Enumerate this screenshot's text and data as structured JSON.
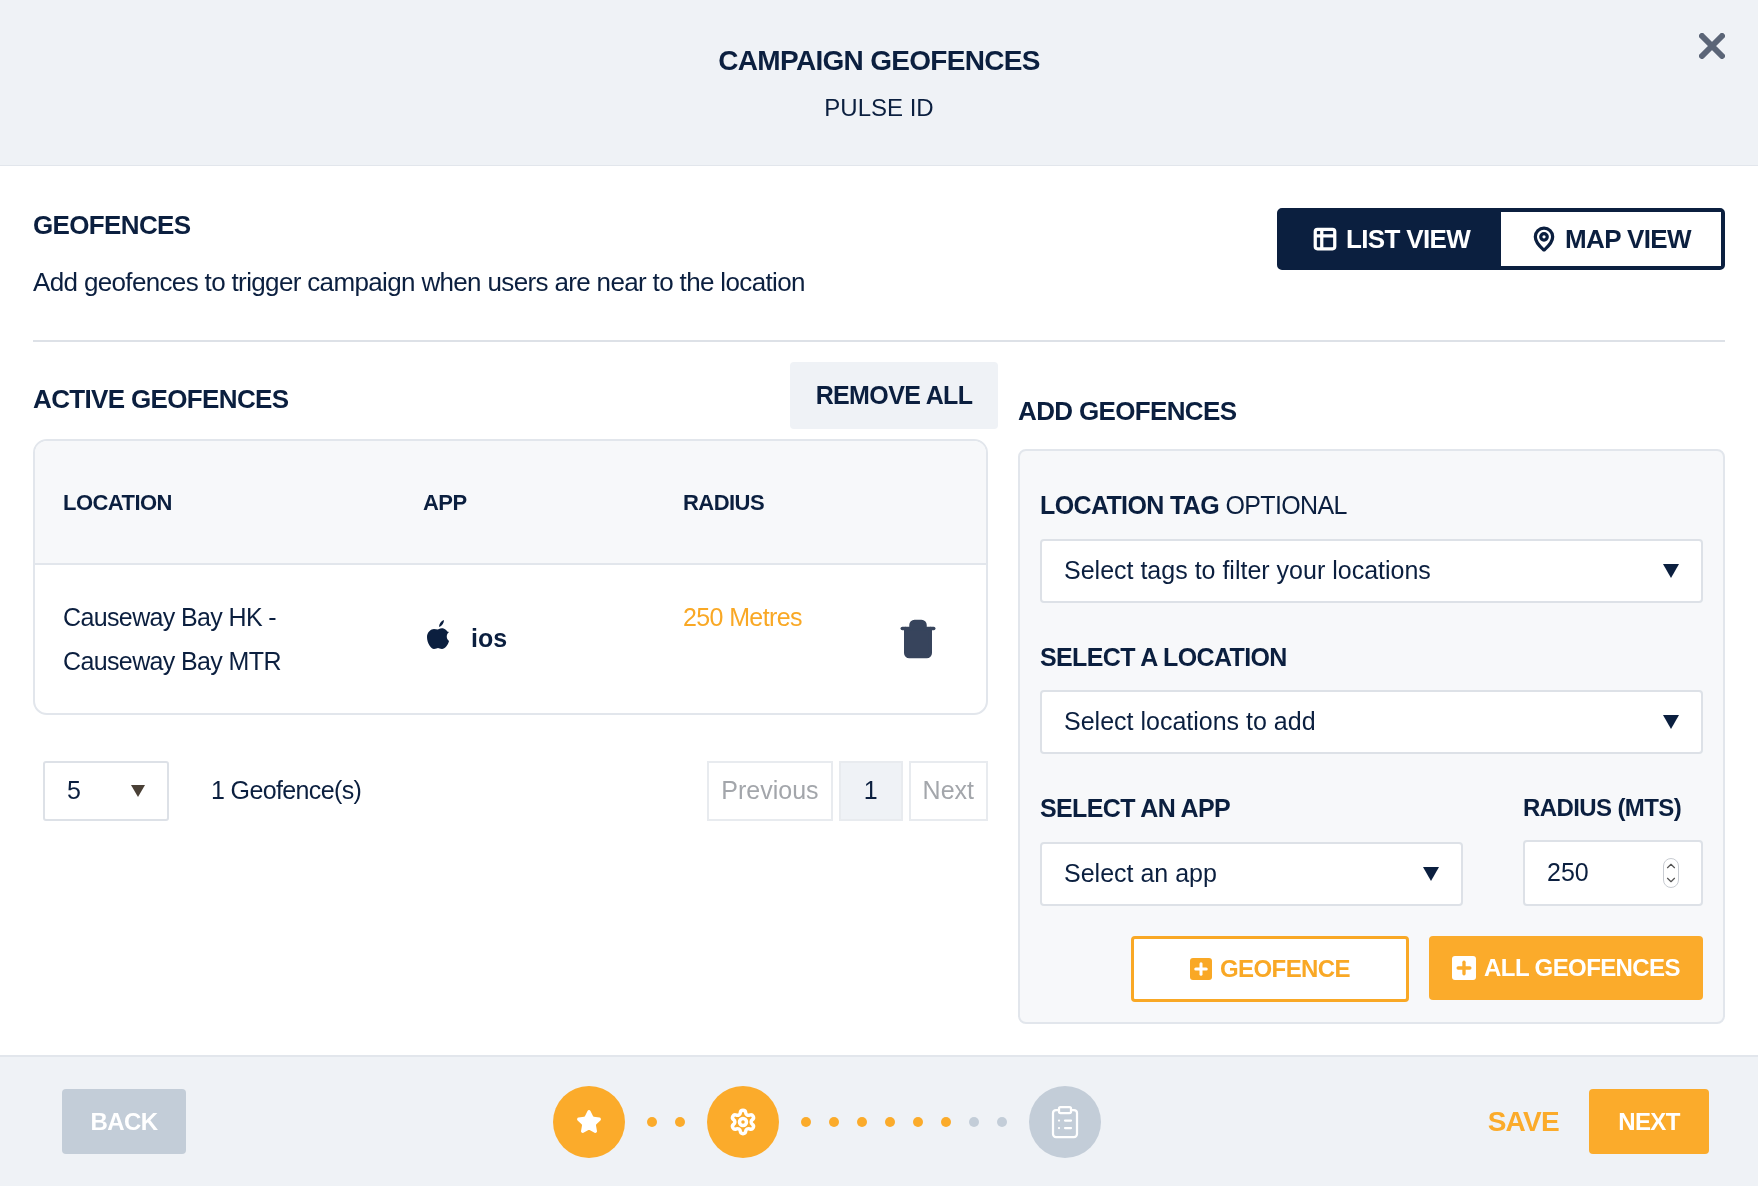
{
  "header": {
    "title": "CAMPAIGN GEOFENCES",
    "subtitle": "PULSE ID"
  },
  "geofences": {
    "title": "GEOFENCES",
    "description": "Add geofences to trigger campaign when users are near to the location",
    "views": [
      {
        "kind": "list",
        "label": "LIST VIEW",
        "selected": true
      },
      {
        "kind": "map",
        "label": "MAP VIEW",
        "selected": false
      }
    ]
  },
  "active": {
    "title": "ACTIVE GEOFENCES",
    "remove_all": "REMOVE ALL",
    "columns": [
      "LOCATION",
      "APP",
      "RADIUS"
    ],
    "rows": [
      {
        "location": "Causeway Bay HK - Causeway Bay MTR",
        "app": "ios",
        "radius": "250 Metres"
      }
    ],
    "page_size": "5",
    "count": "1 Geofence(s)",
    "pages": [
      {
        "label": "Previous",
        "selected": false,
        "disabled": true
      },
      {
        "label": "1",
        "selected": true,
        "disabled": false
      },
      {
        "label": "Next",
        "selected": false,
        "disabled": true
      }
    ]
  },
  "add": {
    "title": "ADD GEOFENCES",
    "tag_label": "LOCATION TAG",
    "tag_hint": "OPTIONAL",
    "tag_placeholder": "Select tags to filter your locations",
    "location_label": "SELECT A LOCATION",
    "location_placeholder": "Select locations to add",
    "app_label": "SELECT AN APP",
    "app_placeholder": "Select an app",
    "radius_label": "RADIUS (MTS)",
    "radius_value": "250",
    "add_one": "GEOFENCE",
    "add_all": "ALL GEOFENCES"
  },
  "footer": {
    "back": "BACK",
    "save": "SAVE",
    "next": "NEXT",
    "steps": [
      {
        "kind": "star",
        "done": true
      },
      {
        "kind": "gear",
        "done": true
      },
      {
        "kind": "clipboard",
        "done": false
      }
    ],
    "connectors": [
      {
        "dots": [
          {
            "done": true
          },
          {
            "done": true
          }
        ]
      },
      {
        "dots": [
          {
            "done": true
          },
          {
            "done": true
          },
          {
            "done": true
          },
          {
            "done": true
          },
          {
            "done": true
          },
          {
            "done": true
          },
          {
            "done": false
          },
          {
            "done": false
          }
        ]
      }
    ]
  }
}
